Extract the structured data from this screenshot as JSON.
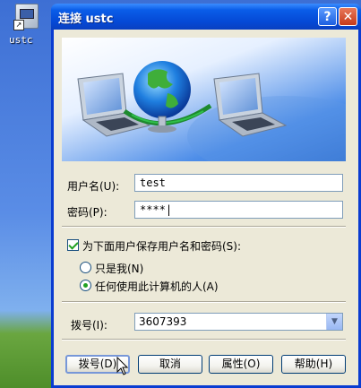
{
  "desktop": {
    "icon_label": "ustc"
  },
  "window": {
    "title": "连接 ustc",
    "help_symbol": "?",
    "close_symbol": "✕"
  },
  "form": {
    "username_label": "用户名(U):",
    "username_value": "test",
    "password_label": "密码(P):",
    "password_value": "****|",
    "save_checkbox_label": "为下面用户保存用户名和密码(S):",
    "radio_me_label": "只是我(N)",
    "radio_anyone_label": "任何使用此计算机的人(A)",
    "dial_label": "拨号(I):",
    "dial_value": "3607393"
  },
  "buttons": {
    "dial": "拨号(D)",
    "cancel": "取消",
    "properties": "属性(O)",
    "help": "帮助(H)"
  },
  "colors": {
    "titlebar": "#0a5de8",
    "client": "#ece9d8",
    "accent_green": "#21a121"
  }
}
